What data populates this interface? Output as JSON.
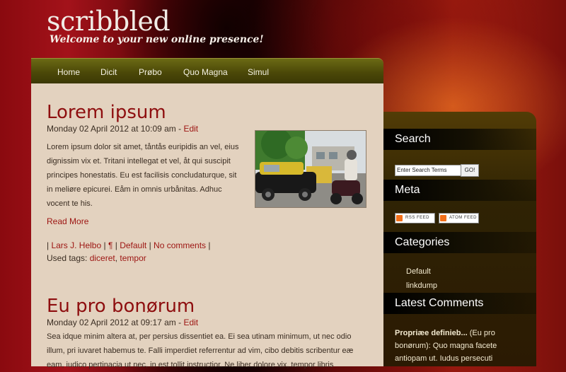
{
  "site": {
    "title": "scribbled",
    "tagline": "Welcome to your new online presence!"
  },
  "nav": {
    "items": [
      "Home",
      "Dicit",
      "Prøbo",
      "Quo Magna",
      "Simul"
    ]
  },
  "posts": [
    {
      "title": "Lorem ipsum",
      "meta_date": "Monday 02 April 2012 at 10:09 am - ",
      "edit": "Edit",
      "excerpt_lines": [
        "Lorem ipsum dolor sit amet, tåntås euripidis an vel, eius",
        "dignissim vix et. Tritani intellegat et vel, åt qui suscipit",
        "principes honestatis. Eu est facilisis concludaturque, sit",
        "in meliøre epicurei. Eåm in omnis urbånitas. Adhuc",
        "vocent te his."
      ],
      "read_more": "Read More",
      "author": "Lars J. Helbo",
      "permalink": "¶",
      "category": "Default",
      "comments": "No comments",
      "tags_label": "Used tags:",
      "tags": [
        "diceret",
        "tempor"
      ]
    },
    {
      "title": "Eu pro bonørum",
      "meta_date": "Monday 02 April 2012 at 09:17 am - ",
      "edit": "Edit",
      "excerpt_lines": [
        "Sea idque minim altera at, per persius dissentiet ea. Ei sea utinam minimum, ut nec odio",
        "illum, pri iuvaret habemus te. Falli imperdiet referrentur ad vim, cibo debitis scribentur eæ",
        "eam, iudico pertinacia ut nec, in est tollit instructior. Ne liber dolore vix, tempor libris"
      ]
    }
  ],
  "sidebar": {
    "search": {
      "title": "Search",
      "value": "Enter Search Terms",
      "button": "GO!"
    },
    "meta": {
      "title": "Meta",
      "rss": "RSS FEED",
      "atom": "ATOM FEED"
    },
    "categories": {
      "title": "Categories",
      "items": [
        "Default",
        "linkdump"
      ]
    },
    "latest_comments": {
      "title": "Latest Comments",
      "author": "Propriæe definieb...",
      "text": "(Eu pro bonørum): Quo magna facete antiopam ut. Iudus persecuti"
    }
  },
  "colors": {
    "accent": "#9c1411",
    "nav_bg": "#4b4808",
    "content_bg": "#e3d2bf",
    "sidebar_bg": "#2f2304"
  }
}
